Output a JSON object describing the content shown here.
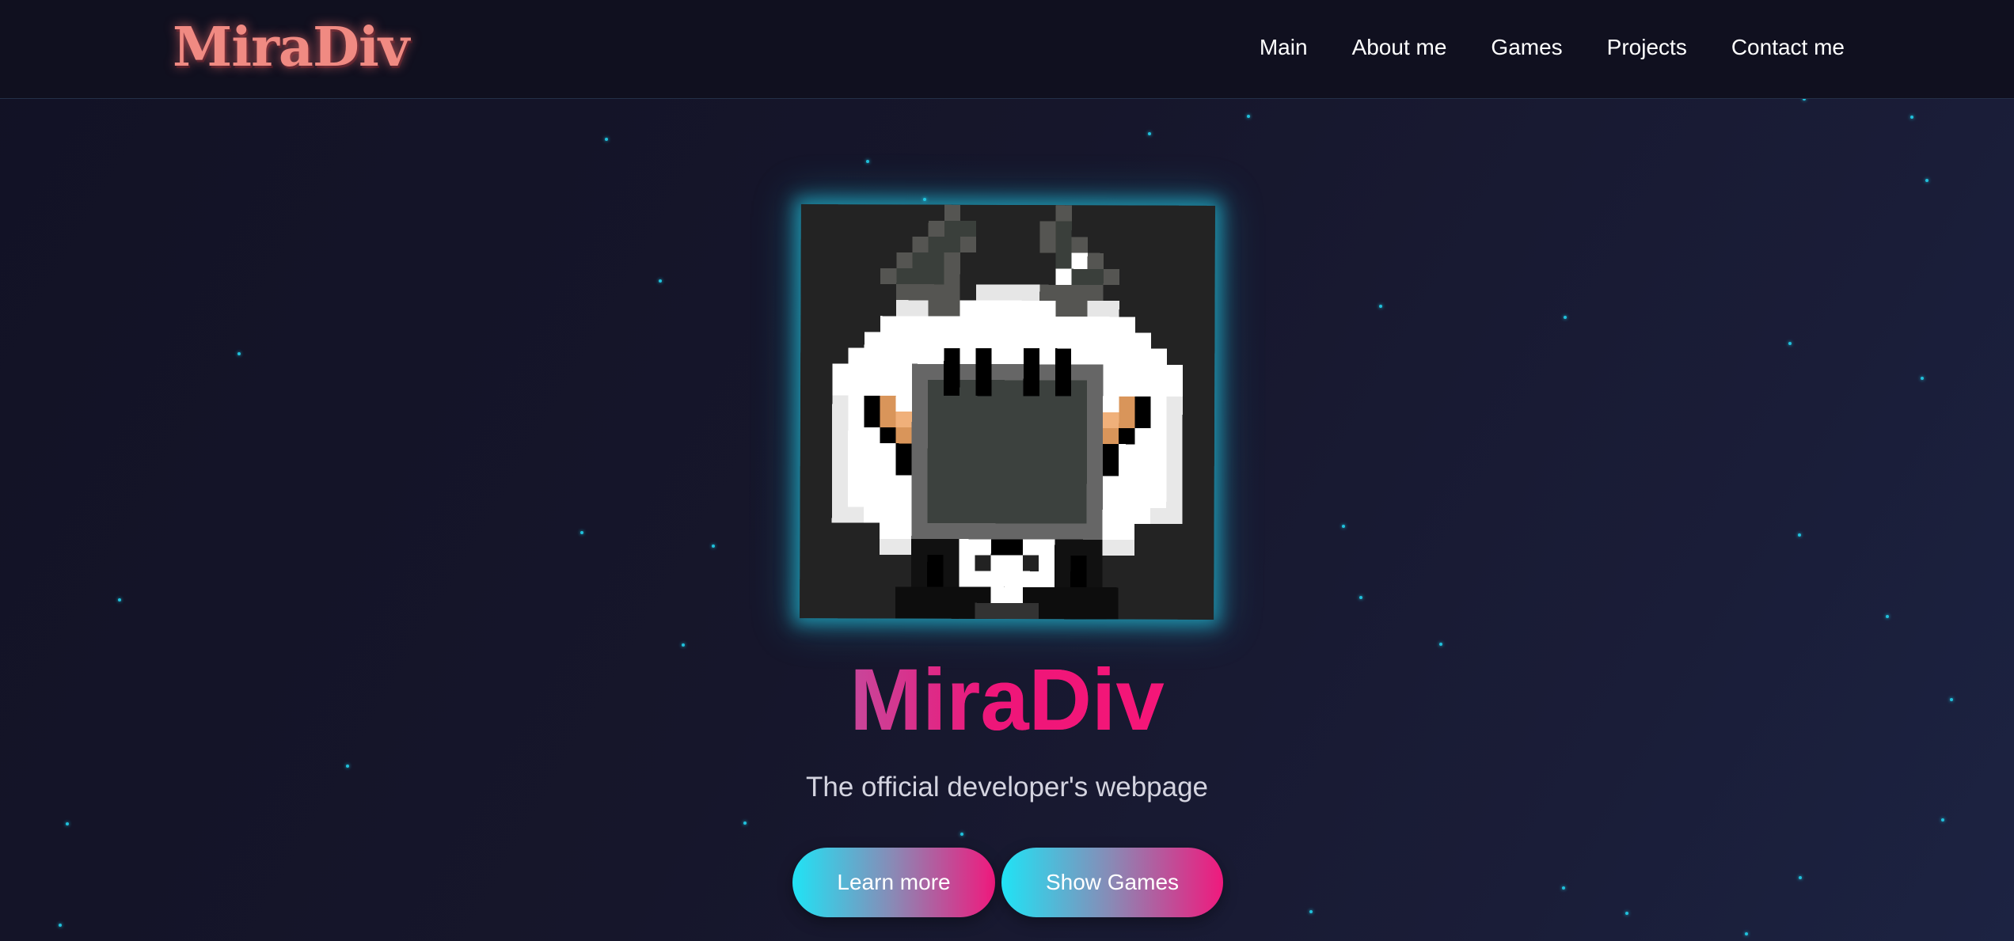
{
  "header": {
    "logo_text": "MiraDiv",
    "nav": [
      {
        "label": "Main"
      },
      {
        "label": "About me"
      },
      {
        "label": "Games"
      },
      {
        "label": "Projects"
      },
      {
        "label": "Contact me"
      }
    ]
  },
  "hero": {
    "avatar_icon": "pixel-art-ghost-avatar-icon",
    "title": "MiraDiv",
    "subtitle": "The official developer's webpage",
    "buttons": {
      "learn_more": "Learn more",
      "show_games": "Show Games"
    }
  },
  "colors": {
    "accent_cyan": "#22d3ee",
    "accent_pink": "#f0197d",
    "logo": "#f08a82",
    "background": "#15152a"
  }
}
